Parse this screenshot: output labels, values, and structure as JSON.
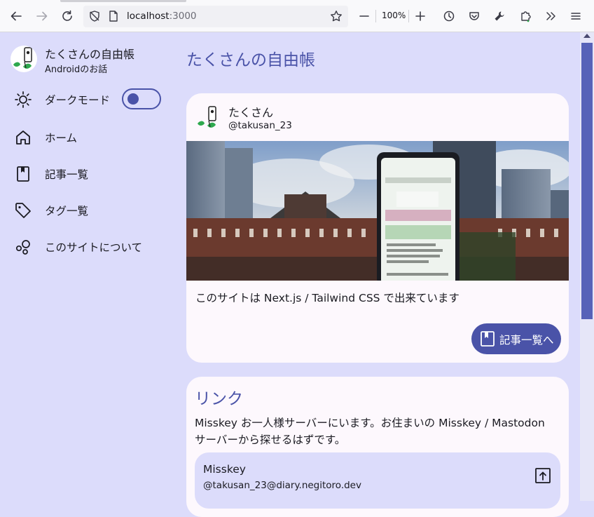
{
  "browser": {
    "url_host": "localhost",
    "url_port": ":3000",
    "zoom_level": "100%"
  },
  "sidebar": {
    "site_title": "たくさんの自由帳",
    "site_subtitle": "Androidのお話",
    "dark_mode_label": "ダークモード",
    "dark_mode_on": false,
    "nav": [
      {
        "label": "ホーム",
        "icon": "home-icon"
      },
      {
        "label": "記事一覧",
        "icon": "bookmark-icon"
      },
      {
        "label": "タグ一覧",
        "icon": "tag-icon"
      },
      {
        "label": "このサイトについて",
        "icon": "bubbles-icon"
      }
    ]
  },
  "main": {
    "page_title": "たくさんの自由帳",
    "profile": {
      "name": "たくさん",
      "handle": "@takusan_23",
      "description": "このサイトは Next.js / Tailwind CSS で出来ています",
      "button_label": "記事一覧へ"
    },
    "links": {
      "title": "リンク",
      "description": "Misskey お一人様サーバーにいます。お住まいの Misskey / Mastodon サーバーから探せるはずです。",
      "accounts": [
        {
          "service": "Misskey",
          "address": "@takusan_23@diary.negitoro.dev"
        }
      ]
    }
  },
  "colors": {
    "background": "#dcdcfb",
    "accent": "#4a53a8",
    "card": "#fdf8fd",
    "text": "#1b1b22"
  }
}
